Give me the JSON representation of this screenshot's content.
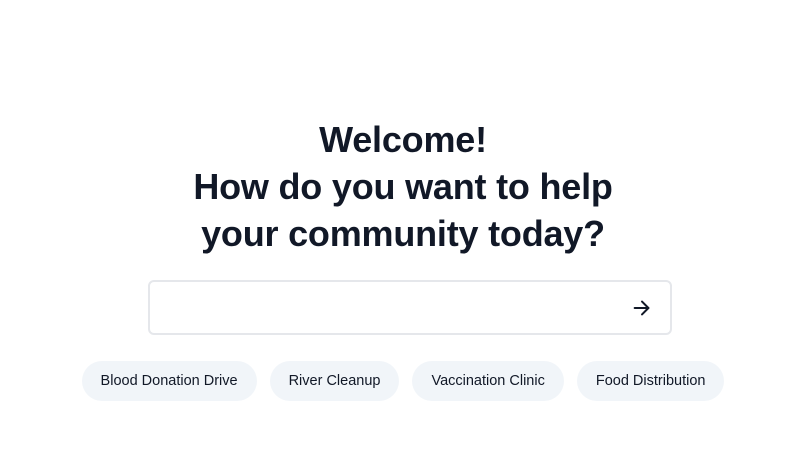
{
  "hero": {
    "line1": "Welcome!",
    "line2": "How do you want to help",
    "line3": "your community today?"
  },
  "search": {
    "value": "",
    "placeholder": "",
    "submit_icon": "arrow-right-icon"
  },
  "suggestions": [
    {
      "label": "Blood Donation Drive"
    },
    {
      "label": "River Cleanup"
    },
    {
      "label": "Vaccination Clinic"
    },
    {
      "label": "Food Distribution"
    }
  ],
  "colors": {
    "heading": "#111827",
    "chip_background": "#f1f5f9",
    "input_border": "#e5e7eb"
  }
}
